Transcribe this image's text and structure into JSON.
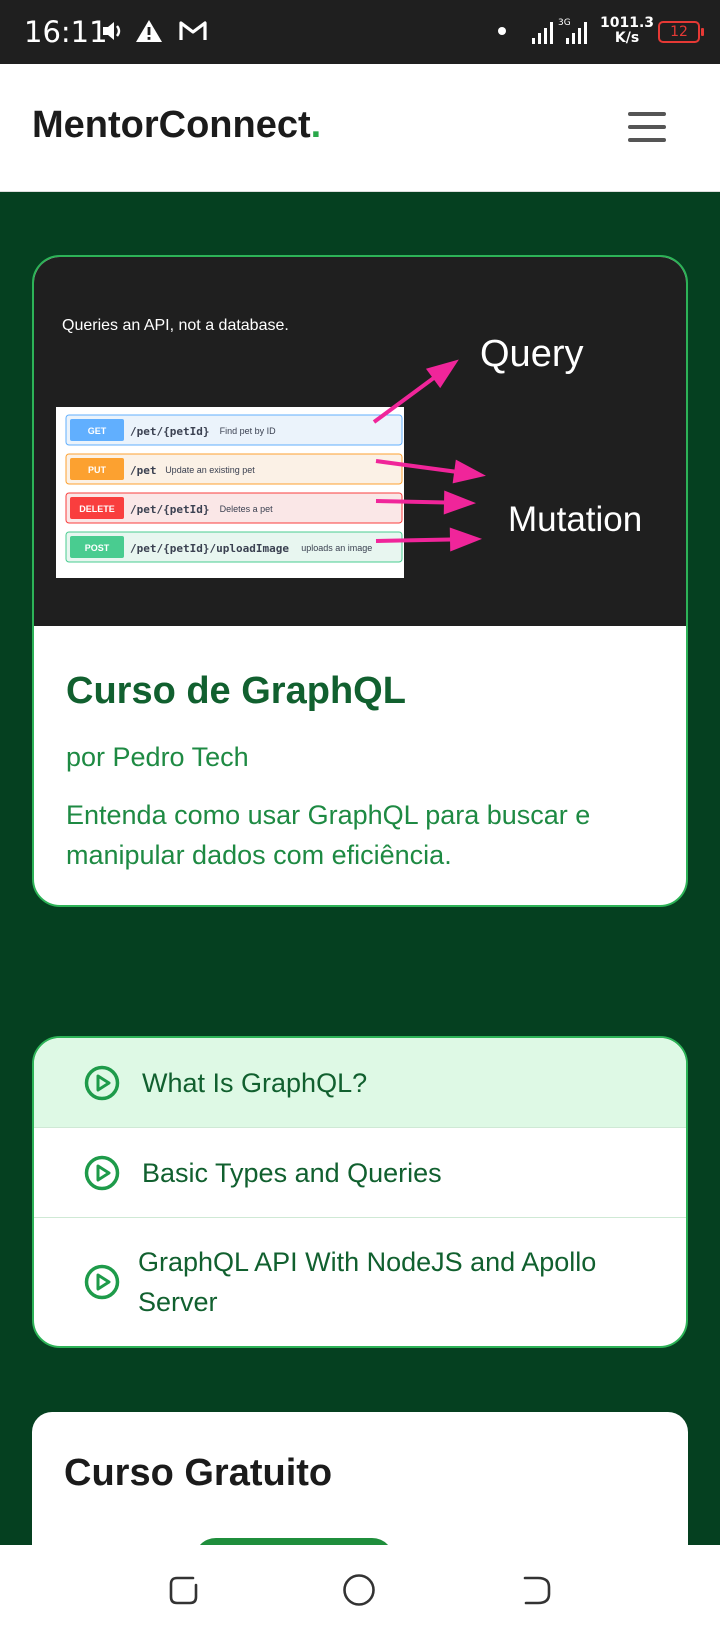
{
  "status_bar": {
    "time": "16:11",
    "network_speed_value": "1011.3",
    "network_speed_unit": "K/s",
    "battery": "12",
    "network_type": "3G",
    "icons": [
      "volume-icon",
      "warning-icon",
      "gmail-icon",
      "dot-icon",
      "signal-icon",
      "battery-icon"
    ]
  },
  "header": {
    "logo": "MentorConnect",
    "logo_dot": ".",
    "menu_icon": "hamburger-menu-icon"
  },
  "course": {
    "image": {
      "caption": "Queries an API, not a database.",
      "query_label": "Query",
      "mutation_label": "Mutation",
      "endpoints": [
        {
          "method": "GET",
          "path": "/pet/{petId}",
          "desc": "Find pet by ID",
          "color": "#61affe",
          "bg": "#ebf3fb",
          "border": "#61affe"
        },
        {
          "method": "PUT",
          "path": "/pet",
          "desc": "Update an existing pet",
          "color": "#fca130",
          "bg": "#fbf1e6",
          "border": "#fca130"
        },
        {
          "method": "DELETE",
          "path": "/pet/{petId}",
          "desc": "Deletes a pet",
          "color": "#f93e3e",
          "bg": "#fae7e7",
          "border": "#f93e3e"
        },
        {
          "method": "POST",
          "path": "/pet/{petId}/uploadImage",
          "desc": "uploads an image",
          "color": "#49cc90",
          "bg": "#e8f6f0",
          "border": "#49cc90"
        }
      ],
      "arrow_color": "#f0259a"
    },
    "title": "Curso de GraphQL",
    "author": "por Pedro Tech",
    "description": "Entenda como usar GraphQL para buscar e manipular dados com eficiência."
  },
  "lessons": [
    {
      "label": "What Is GraphQL?",
      "active": true,
      "icon": "play-circle-icon"
    },
    {
      "label": "Basic Types and Queries",
      "active": false,
      "icon": "play-circle-icon"
    },
    {
      "label": "GraphQL API With NodeJS and Apollo Server",
      "active": false,
      "icon": "play-circle-icon"
    }
  ],
  "free_course": {
    "title": "Curso Gratuito"
  },
  "nav_bar": {
    "icons": [
      "recent-apps-icon",
      "home-icon",
      "back-icon"
    ]
  },
  "colors": {
    "page_bg": "#054020",
    "accent": "#2db357",
    "title_green": "#11602f",
    "text_green": "#1e8a43",
    "active_bg": "#def9e5"
  }
}
